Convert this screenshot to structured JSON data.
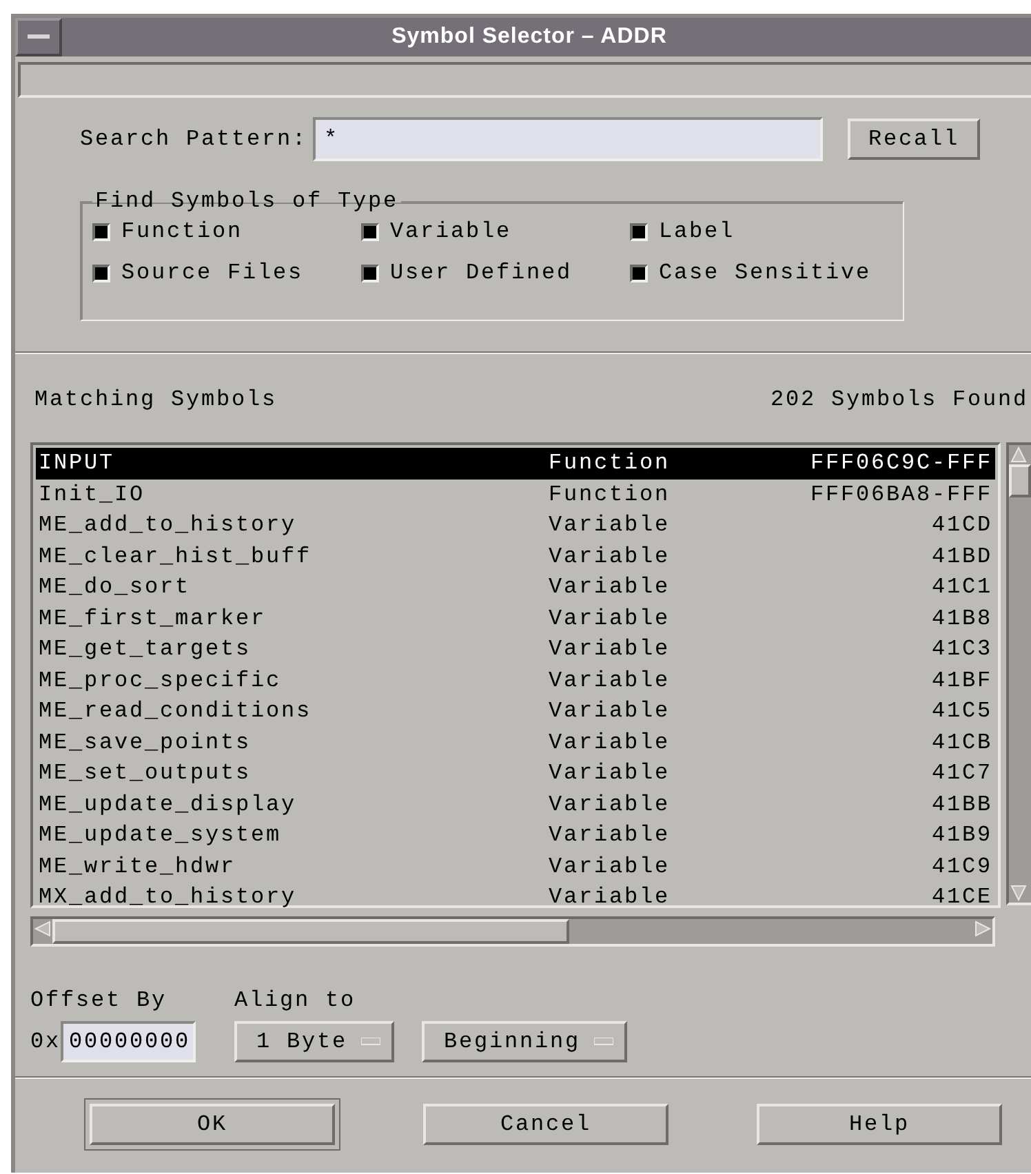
{
  "window": {
    "title": "Symbol Selector – ADDR"
  },
  "search": {
    "label": "Search Pattern:",
    "value": "*",
    "button": "Recall"
  },
  "find_types": {
    "title": "Find Symbols of Type",
    "options": [
      {
        "label": "Function",
        "checked": true
      },
      {
        "label": "Variable",
        "checked": true
      },
      {
        "label": "Label",
        "checked": true
      },
      {
        "label": "Source Files",
        "checked": true
      },
      {
        "label": "User Defined",
        "checked": true
      },
      {
        "label": "Case Sensitive",
        "checked": true
      }
    ]
  },
  "matching": {
    "label": "Matching Symbols",
    "count": "202 Symbols Found"
  },
  "rows": [
    {
      "name": "INPUT",
      "type": "Function",
      "address": "FFF06C9C-FFF",
      "selected": true
    },
    {
      "name": "Init_IO",
      "type": "Function",
      "address": "FFF06BA8-FFF",
      "selected": false
    },
    {
      "name": "ME_add_to_history",
      "type": "Variable",
      "address": "41CD",
      "selected": false
    },
    {
      "name": "ME_clear_hist_buff",
      "type": "Variable",
      "address": "41BD",
      "selected": false
    },
    {
      "name": "ME_do_sort",
      "type": "Variable",
      "address": "41C1",
      "selected": false
    },
    {
      "name": "ME_first_marker",
      "type": "Variable",
      "address": "41B8",
      "selected": false
    },
    {
      "name": "ME_get_targets",
      "type": "Variable",
      "address": "41C3",
      "selected": false
    },
    {
      "name": "ME_proc_specific",
      "type": "Variable",
      "address": "41BF",
      "selected": false
    },
    {
      "name": "ME_read_conditions",
      "type": "Variable",
      "address": "41C5",
      "selected": false
    },
    {
      "name": "ME_save_points",
      "type": "Variable",
      "address": "41CB",
      "selected": false
    },
    {
      "name": "ME_set_outputs",
      "type": "Variable",
      "address": "41C7",
      "selected": false
    },
    {
      "name": "ME_update_display",
      "type": "Variable",
      "address": "41BB",
      "selected": false
    },
    {
      "name": "ME_update_system",
      "type": "Variable",
      "address": "41B9",
      "selected": false
    },
    {
      "name": "ME_write_hdwr",
      "type": "Variable",
      "address": "41C9",
      "selected": false
    },
    {
      "name": "MX_add_to_history",
      "type": "Variable",
      "address": "41CE",
      "selected": false
    }
  ],
  "offset": {
    "label": "Offset By",
    "prefix": "0x",
    "value": "00000000"
  },
  "align": {
    "label": "Align to",
    "dropdowns": [
      "1 Byte",
      "Beginning"
    ]
  },
  "buttons": [
    {
      "label": "OK",
      "default": true
    },
    {
      "label": "Cancel",
      "default": false
    },
    {
      "label": "Help",
      "default": false
    }
  ]
}
